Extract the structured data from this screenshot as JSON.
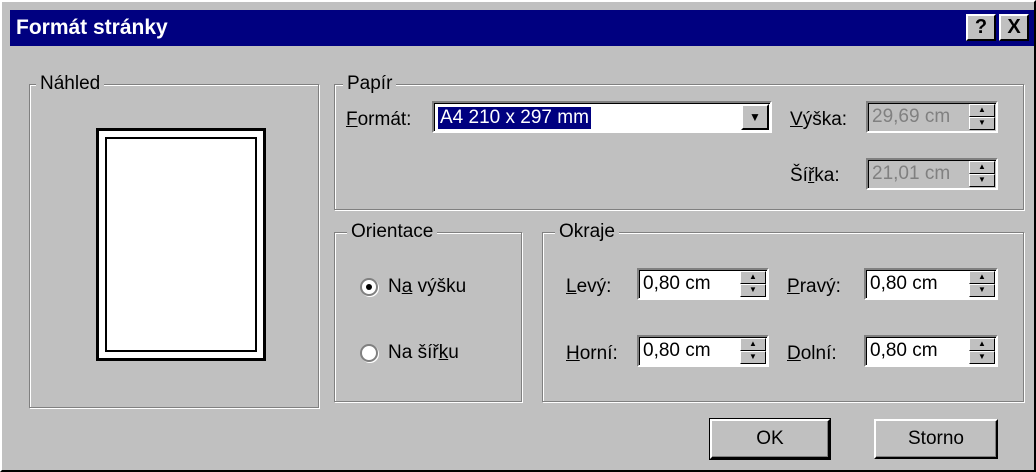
{
  "title": "Formát stránky",
  "title_buttons": {
    "help": "?",
    "close": "X"
  },
  "preview": {
    "legend": "Náhled"
  },
  "paper": {
    "legend": "Papír",
    "format_label_u": "F",
    "format_label_rest": "ormát:",
    "format_value": "A4 210 x 297 mm",
    "height_label_u": "V",
    "height_label_rest": "ýška:",
    "height_value": "29,69 cm",
    "width_label_pre": "Ší",
    "width_label_u": "ř",
    "width_label_rest": "ka:",
    "width_value": "21,01 cm"
  },
  "orientation": {
    "legend": "Orientace",
    "portrait_pre": "N",
    "portrait_u": "a",
    "portrait_rest": " výšku",
    "portrait_selected": true,
    "landscape_pre": "Na šíř",
    "landscape_u": "k",
    "landscape_rest": "u"
  },
  "margins": {
    "legend": "Okraje",
    "left_label_u": "L",
    "left_label_rest": "evý:",
    "left_value": "0,80 cm",
    "right_label_u": "P",
    "right_label_rest": "ravý:",
    "right_value": "0,80 cm",
    "top_label_u": "H",
    "top_label_rest": "orní:",
    "top_value": "0,80 cm",
    "bottom_label_u": "D",
    "bottom_label_rest": "olní:",
    "bottom_value": "0,80 cm"
  },
  "buttons": {
    "ok": "OK",
    "cancel": "Storno"
  }
}
